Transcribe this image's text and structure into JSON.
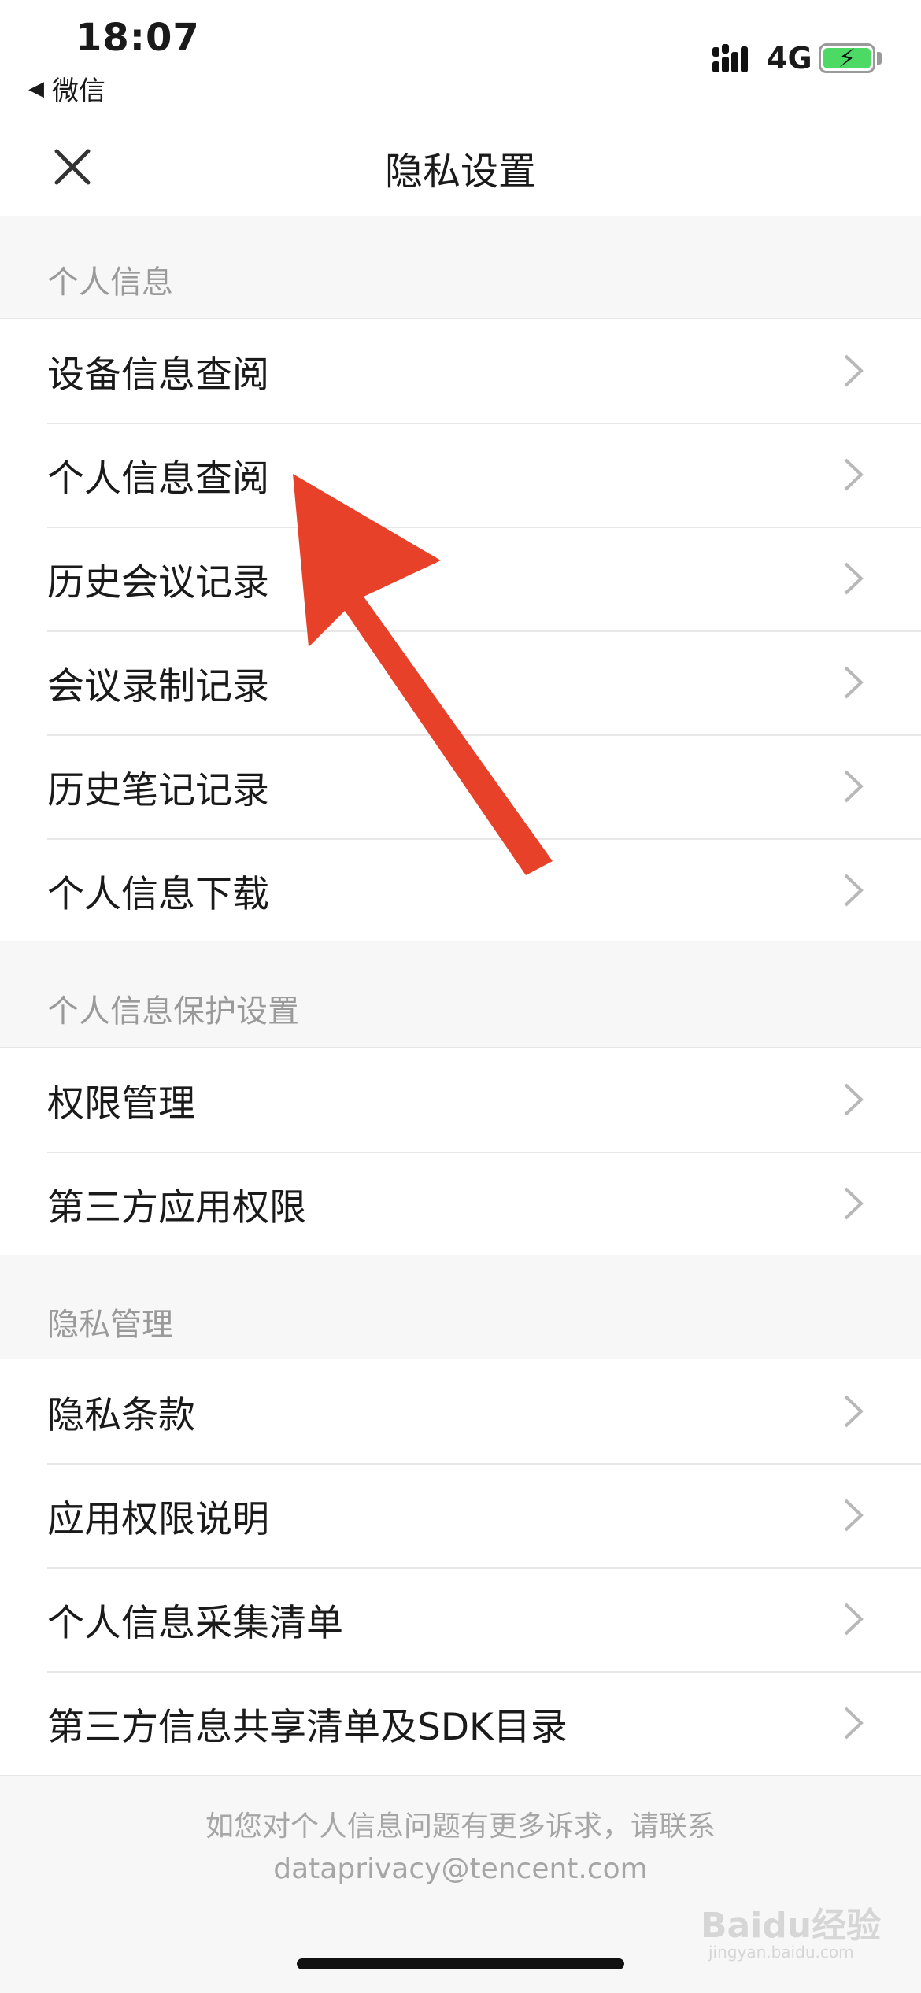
{
  "status_bar": {
    "time": "18:07",
    "back_app": "微信",
    "network": "4G"
  },
  "nav": {
    "title": "隐私设置"
  },
  "sections": [
    {
      "header": "个人信息",
      "items": [
        "设备信息查阅",
        "个人信息查阅",
        "历史会议记录",
        "会议录制记录",
        "历史笔记记录",
        "个人信息下载"
      ]
    },
    {
      "header": "个人信息保护设置",
      "items": [
        "权限管理",
        "第三方应用权限"
      ]
    },
    {
      "header": "隐私管理",
      "items": [
        "隐私条款",
        "应用权限说明",
        "个人信息采集清单",
        "第三方信息共享清单及SDK目录"
      ]
    }
  ],
  "footer": {
    "line1": "如您对个人信息问题有更多诉求，请联系",
    "line2": "dataprivacy@tencent.com"
  },
  "watermark": {
    "brand": "Baidu经验",
    "url": "jingyan.baidu.com"
  },
  "colors": {
    "arrow": "#e8412a",
    "battery": "#4cd964"
  }
}
